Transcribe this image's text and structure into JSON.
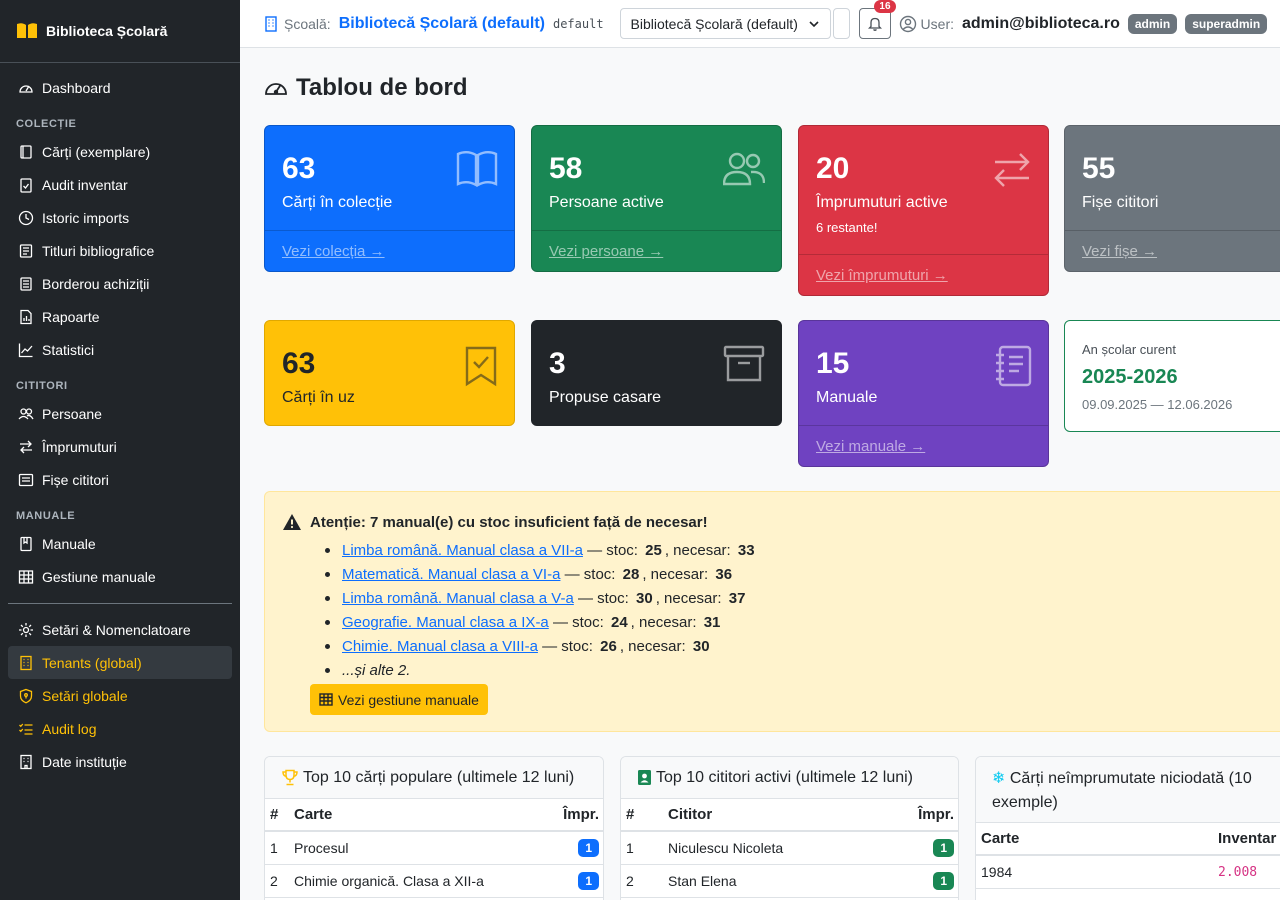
{
  "brand": {
    "title": "Biblioteca Școlară"
  },
  "sidebar": {
    "dashboard": "Dashboard",
    "section_collection": "COLECȚIE",
    "collection_items": [
      "Cărți (exemplare)",
      "Audit inventar",
      "Istoric imports",
      "Titluri bibliografice",
      "Borderou achiziții",
      "Rapoarte",
      "Statistici"
    ],
    "section_readers": "CITITORI",
    "reader_items": [
      "Persoane",
      "Împrumuturi",
      "Fișe cititori"
    ],
    "section_manuals": "MANUALE",
    "manual_items": [
      "Manuale",
      "Gestiune manuale"
    ],
    "settings": "Setări & Nomenclatoare",
    "tenants": "Tenants (global)",
    "global_settings": "Setări globale",
    "audit_log": "Audit log",
    "institution": "Date instituție"
  },
  "topbar": {
    "school_label": "Școală:",
    "school_name": "Bibliotecă Școlară (default)",
    "slug": "default",
    "select_value": "Bibliotecă Școlară (default)",
    "notifications": "16",
    "user_label": "User:",
    "email": "admin@biblioteca.ro",
    "roles": [
      "admin",
      "superadmin"
    ]
  },
  "page": {
    "title": "Tablou de bord"
  },
  "cards": {
    "books": {
      "value": "63",
      "label": "Cărți în colecție",
      "link": "Vezi colecția →"
    },
    "persons": {
      "value": "58",
      "label": "Persoane active",
      "link": "Vezi persoane →"
    },
    "loans": {
      "value": "20",
      "label": "Împrumuturi active",
      "sub": "6 restante!",
      "link": "Vezi împrumuturi →"
    },
    "readers": {
      "value": "55",
      "label": "Fișe cititori",
      "link": "Vezi fișe →"
    },
    "in_use": {
      "value": "63",
      "label": "Cărți în uz"
    },
    "disposal": {
      "value": "3",
      "label": "Propuse casare"
    },
    "manuals": {
      "value": "15",
      "label": "Manuale",
      "link": "Vezi manuale →"
    },
    "school_year": {
      "label": "An școlar curent",
      "value": "2025-2026",
      "range": "09.09.2025 — 12.06.2026"
    }
  },
  "alert": {
    "title": "Atenție: 7 manual(e) cu stoc insuficient față de necesar!",
    "items": [
      {
        "name": "Limba română. Manual clasa a VII-a",
        "stock": "25",
        "need": "33"
      },
      {
        "name": "Matematică. Manual clasa a VI-a",
        "stock": "28",
        "need": "36"
      },
      {
        "name": "Limba română. Manual clasa a V-a",
        "stock": "30",
        "need": "37"
      },
      {
        "name": "Geografie. Manual clasa a IX-a",
        "stock": "24",
        "need": "31"
      },
      {
        "name": "Chimie. Manual clasa a VIII-a",
        "stock": "26",
        "need": "30"
      }
    ],
    "sep_stock": "— stoc:",
    "sep_need": ", necesar:",
    "more": "...și alte 2.",
    "button": "Vezi gestiune manuale"
  },
  "popular": {
    "title": "Top 10 cărți populare (ultimele 12 luni)",
    "columns": [
      "#",
      "Carte",
      "Împr."
    ],
    "rows": [
      {
        "n": "1",
        "title": "Procesul",
        "count": "1"
      },
      {
        "n": "2",
        "title": "Chimie organică. Clasa a XII-a",
        "count": "1"
      }
    ]
  },
  "active_readers": {
    "title": "Top 10 cititori activi (ultimele 12 luni)",
    "columns": [
      "#",
      "Cititor",
      "Împr."
    ],
    "rows": [
      {
        "n": "1",
        "name": "Niculescu Nicoleta",
        "count": "1"
      },
      {
        "n": "2",
        "name": "Stan Elena",
        "count": "1"
      }
    ]
  },
  "never_borrowed": {
    "title": "Cărți neîmprumutate niciodată (10 exemple)",
    "columns": [
      "Carte",
      "Inventar"
    ],
    "rows": [
      {
        "title": "1984",
        "inventory": "2.008"
      }
    ]
  }
}
